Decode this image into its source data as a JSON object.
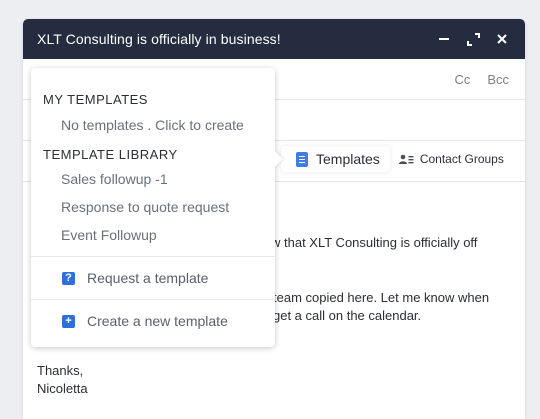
{
  "window": {
    "title": "XLT Consulting is officially in business!"
  },
  "compose": {
    "cc_label": "Cc",
    "bcc_label": "Bcc",
    "templates_label": "Templates",
    "contact_groups_label": "Contact Groups",
    "body_line1": "w that XLT Consulting is officially off",
    "body_line2": "team copied here. Let me know when",
    "body_line3": "get a call on the calendar.",
    "signoff": "Thanks,",
    "signature": "Nicoletta"
  },
  "menu": {
    "my_templates_heading": "MY TEMPLATES",
    "no_templates_text": "No templates . Click to create",
    "library_heading": "TEMPLATE LIBRARY",
    "library_items": [
      "Sales followup -1",
      "Response to quote request",
      "Event Followup"
    ],
    "request_label": "Request a template",
    "create_label": "Create a new template"
  },
  "colors": {
    "titlebar": "#252c3f",
    "accent": "#2f6fdb",
    "background": "#eceef1"
  },
  "icons": [
    "minimize-icon",
    "expand-icon",
    "close-icon",
    "document-icon",
    "contact-groups-icon",
    "question-icon",
    "plus-icon"
  ]
}
